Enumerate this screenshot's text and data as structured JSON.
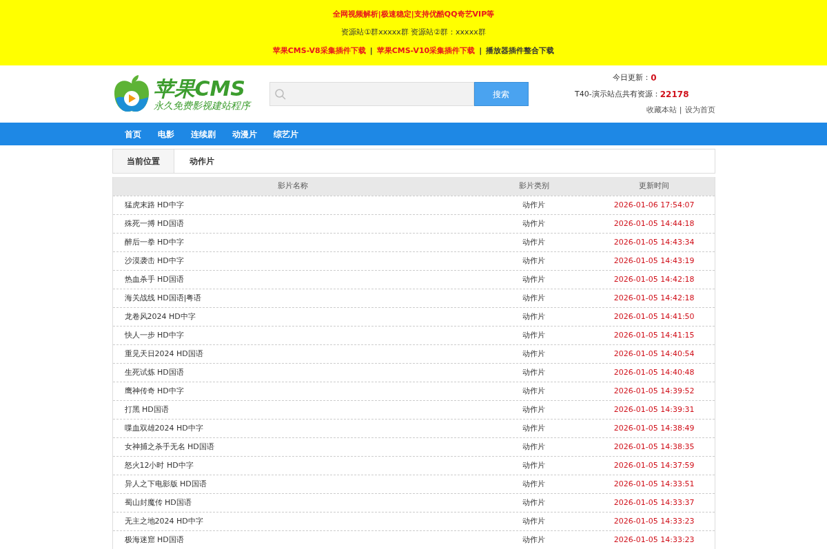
{
  "banner": {
    "headline": "全网视频解析|极速稳定|支持优酷QQ奇艺VIP等",
    "groups": "资源站①群xxxxx群 资源站②群：xxxxx群",
    "links": [
      {
        "label": "苹果CMS-V8采集插件下载",
        "color": "#e8161c"
      },
      {
        "label": "苹果CMS-V10采集插件下载",
        "color": "#e8161c"
      },
      {
        "label": "播放器插件整合下载",
        "color": "#333333"
      }
    ],
    "separator": "|"
  },
  "header": {
    "logo_title": "苹果CMS",
    "logo_tagline": "永久免费影视建站程序",
    "search": {
      "button": "搜索"
    },
    "today_label": "今日更新：",
    "today_value": "0",
    "total_label": "T40-演示站点共有资源：",
    "total_value": "22178",
    "bookmark": "收藏本站",
    "separator": "|",
    "homepage": "设为首页"
  },
  "nav": [
    {
      "label": "首页"
    },
    {
      "label": "电影"
    },
    {
      "label": "连续剧"
    },
    {
      "label": "动漫片"
    },
    {
      "label": "综艺片"
    }
  ],
  "breadcrumb": {
    "label": "当前位置",
    "current": "动作片"
  },
  "table": {
    "columns": [
      "影片名称",
      "影片类别",
      "更新时间"
    ],
    "rows": [
      {
        "name": "猛虎末路 HD中字",
        "category": "动作片",
        "time": "2026-01-06 17:54:07"
      },
      {
        "name": "殊死一搏 HD国语",
        "category": "动作片",
        "time": "2026-01-05 14:44:18"
      },
      {
        "name": "醉后一拳 HD中字",
        "category": "动作片",
        "time": "2026-01-05 14:43:34"
      },
      {
        "name": "沙漠袭击 HD中字",
        "category": "动作片",
        "time": "2026-01-05 14:43:19"
      },
      {
        "name": "热血杀手 HD国语",
        "category": "动作片",
        "time": "2026-01-05 14:42:18"
      },
      {
        "name": "海关战线 HD国语|粤语",
        "category": "动作片",
        "time": "2026-01-05 14:42:18"
      },
      {
        "name": "龙卷风2024 HD中字",
        "category": "动作片",
        "time": "2026-01-05 14:41:50"
      },
      {
        "name": "快人一步 HD中字",
        "category": "动作片",
        "time": "2026-01-05 14:41:15"
      },
      {
        "name": "重见天日2024 HD国语",
        "category": "动作片",
        "time": "2026-01-05 14:40:54"
      },
      {
        "name": "生死试炼 HD国语",
        "category": "动作片",
        "time": "2026-01-05 14:40:48"
      },
      {
        "name": "鹰神传奇 HD中字",
        "category": "动作片",
        "time": "2026-01-05 14:39:52"
      },
      {
        "name": "打黑 HD国语",
        "category": "动作片",
        "time": "2026-01-05 14:39:31"
      },
      {
        "name": "喋血双雄2024 HD中字",
        "category": "动作片",
        "time": "2026-01-05 14:38:49"
      },
      {
        "name": "女神捕之杀手无名 HD国语",
        "category": "动作片",
        "time": "2026-01-05 14:38:35"
      },
      {
        "name": "怒火12小时 HD中字",
        "category": "动作片",
        "time": "2026-01-05 14:37:59"
      },
      {
        "name": "异人之下电影版 HD国语",
        "category": "动作片",
        "time": "2026-01-05 14:33:51"
      },
      {
        "name": "蜀山封魔传 HD国语",
        "category": "动作片",
        "time": "2026-01-05 14:33:37"
      },
      {
        "name": "无主之地2024 HD中字",
        "category": "动作片",
        "time": "2026-01-05 14:33:23"
      },
      {
        "name": "极海迷窟 HD国语",
        "category": "动作片",
        "time": "2026-01-05 14:33:23"
      }
    ]
  }
}
